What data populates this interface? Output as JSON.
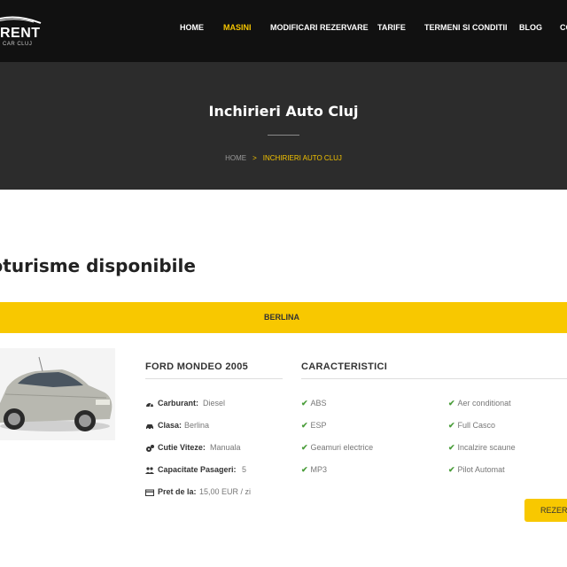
{
  "header": {
    "logo_text": "RENT",
    "logo_sub": "CAR CLUJ",
    "nav": [
      {
        "label": "HOME",
        "active": false
      },
      {
        "label": "MASINI",
        "active": true
      },
      {
        "label": "MODIFICARI REZERVARE",
        "active": false
      },
      {
        "label": "TARIFE",
        "active": false
      },
      {
        "label": "TERMENI SI CONDITII",
        "active": false
      },
      {
        "label": "BLOG",
        "active": false
      },
      {
        "label": "CO",
        "active": false
      }
    ]
  },
  "hero": {
    "title": "Inchirieri Auto Cluj",
    "breadcrumb": {
      "home": "HOME",
      "separator": ">",
      "current": "INCHIRIERI AUTO CLUJ"
    }
  },
  "section": {
    "title": "toturisme disponibile"
  },
  "category": {
    "label": "BERLINA"
  },
  "car": {
    "name": "FORD MONDEO 2005",
    "specs": [
      {
        "label": "Carburant:",
        "value": "Diesel",
        "icon": "fuel-gauge-icon"
      },
      {
        "label": "Clasa:",
        "value": "Berlina",
        "icon": "car-icon"
      },
      {
        "label": "Cutie Viteze:",
        "value": "Manuala",
        "icon": "gears-icon"
      },
      {
        "label": "Capacitate Pasageri:",
        "value": "5",
        "icon": "users-icon"
      },
      {
        "label": "Pret de la:",
        "value": "15,00 EUR / zi",
        "icon": "credit-card-icon"
      }
    ],
    "features_title": "CARACTERISTICI",
    "features_left": [
      "ABS",
      "ESP",
      "Geamuri electrice",
      "MP3"
    ],
    "features_right": [
      "Aer conditionat",
      "Full Casco",
      "Incalzire scaune",
      "Pilot Automat"
    ],
    "reserve_label": "REZERVA"
  },
  "colors": {
    "accent": "#f8c800",
    "dark": "#111111",
    "hero_bg": "#2c2c2c",
    "check": "#4a9d3a"
  }
}
